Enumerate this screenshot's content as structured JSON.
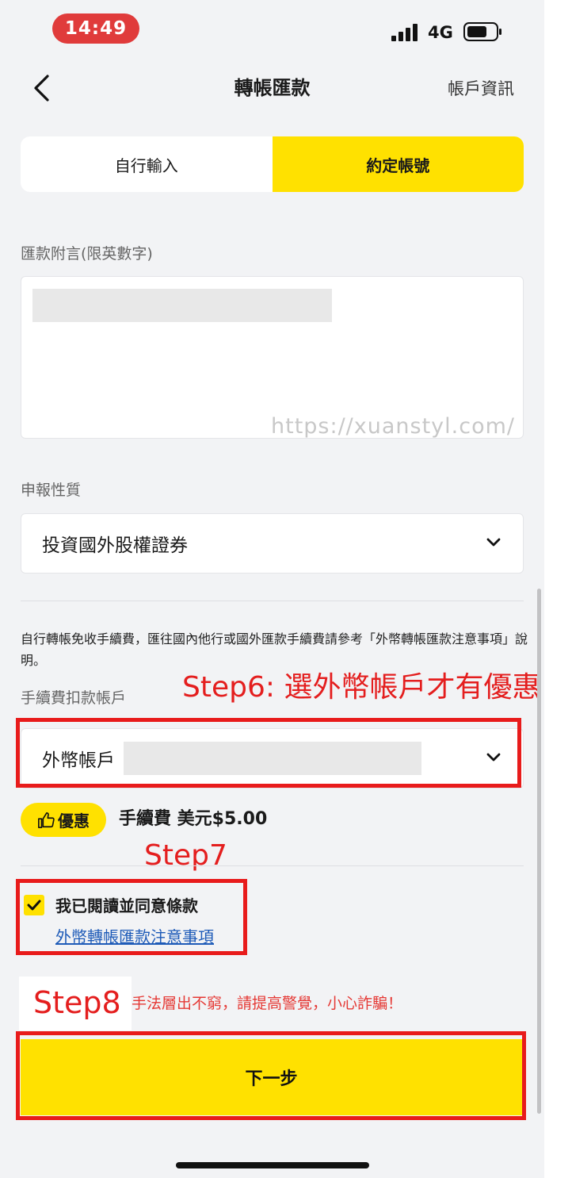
{
  "status_bar": {
    "time": "14:49",
    "network": "4G",
    "time_pill_color": "#e03b3b",
    "icons": [
      "signal-icon",
      "battery-icon"
    ]
  },
  "nav": {
    "title": "轉帳匯款",
    "right_link": "帳戶資訊",
    "back_icon": "chevron-left-icon"
  },
  "tabs": [
    {
      "label": "自行輸入",
      "active": false
    },
    {
      "label": "約定帳號",
      "active": true
    }
  ],
  "memo": {
    "label": "匯款附言(限英數字)"
  },
  "watermark": "https://xuanstyl.com/",
  "declaration": {
    "label": "申報性質",
    "value": "投資國外股權證券"
  },
  "notice": "自行轉帳免收手續費，匯往國內他行或國外匯款手續費請參考「外幣轉帳匯款注意事項」說明。",
  "fee_account": {
    "label": "手續費扣款帳戶",
    "value": "外幣帳戶"
  },
  "promo": {
    "badge": "優惠",
    "badge_icon": "thumbs-up-icon",
    "fee": "手續費 美元$5.00"
  },
  "agreement": {
    "checked": true,
    "text": "我已閱讀並同意條款",
    "link": "外幣轉帳匯款注意事項"
  },
  "annotations": {
    "step6": "Step6: 選外幣帳戶才有優惠",
    "step7": "Step7",
    "step8": "Step8",
    "highlight_color": "#e81b1b"
  },
  "fraud_warning": "手法層出不窮，請提高警覺，小心詐騙！",
  "next_button": "下一步",
  "colors": {
    "accent": "#ffe100",
    "background": "#f2f3f5",
    "link": "#1e5bb8",
    "warning": "#e53935"
  }
}
